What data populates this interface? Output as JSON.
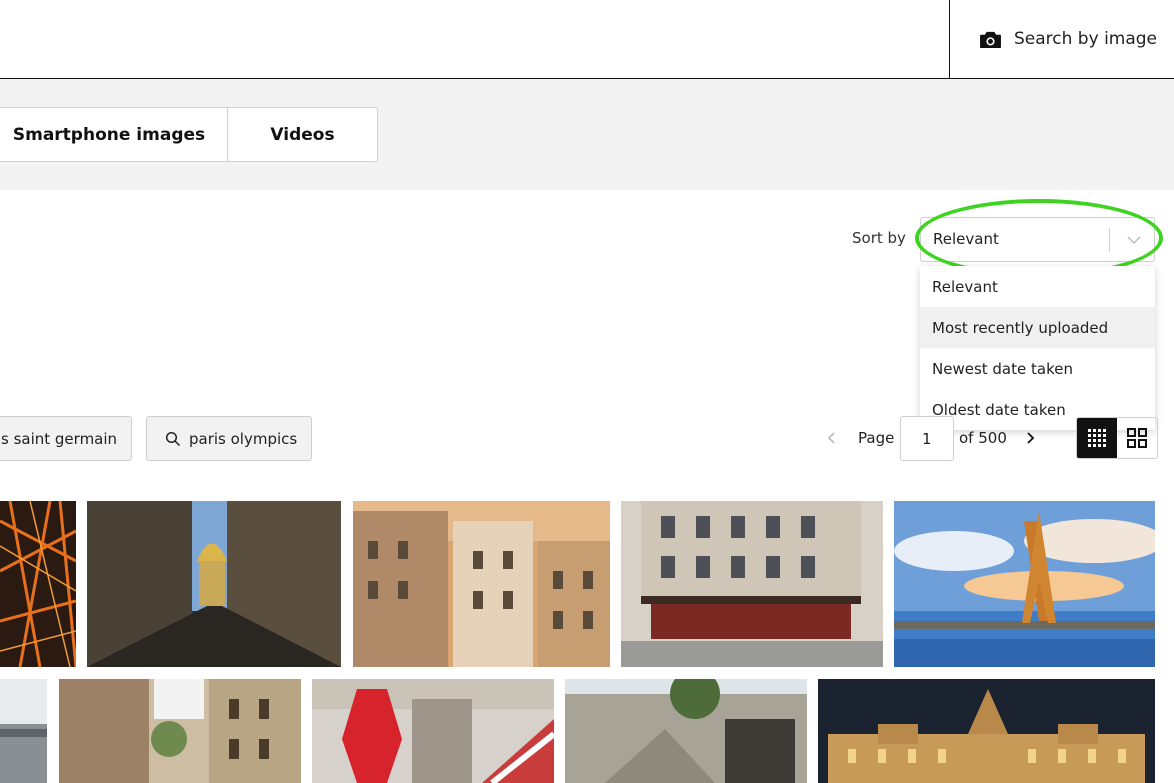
{
  "header": {
    "search_by_image_label": "Search by image"
  },
  "type_tabs": [
    {
      "label": "Smartphone images"
    },
    {
      "label": "Videos"
    }
  ],
  "sort": {
    "label": "Sort by",
    "selected": "Relevant",
    "options": [
      "Relevant",
      "Most recently uploaded",
      "Newest date taken",
      "Oldest date taken"
    ],
    "hovered_option": "Most recently uploaded"
  },
  "related_searches": [
    {
      "label": "s saint germain"
    },
    {
      "label": "paris olympics"
    }
  ],
  "pagination": {
    "page_label": "Page",
    "current_page": "1",
    "of_label": "of 500"
  },
  "colors": {
    "highlight": "#3fd321",
    "band_background": "#f3f3f3",
    "active_view": "#111111"
  },
  "icons": [
    "camera-icon",
    "chevron-down-icon",
    "search-icon",
    "chevron-left-icon",
    "chevron-right-icon",
    "compact-grid-icon",
    "large-grid-icon"
  ],
  "results": [
    {
      "subject": "aerial night city streets"
    },
    {
      "subject": "narrow street with golden dome"
    },
    {
      "subject": "parisian building facades at sunset"
    },
    {
      "subject": "corner cafe building"
    },
    {
      "subject": "eiffel tower over river"
    },
    {
      "subject": "building facade"
    },
    {
      "subject": "old street with balconies"
    },
    {
      "subject": "tabac sign on storefront"
    },
    {
      "subject": "stone building with stairs"
    },
    {
      "subject": "city hall illuminated at night"
    }
  ]
}
